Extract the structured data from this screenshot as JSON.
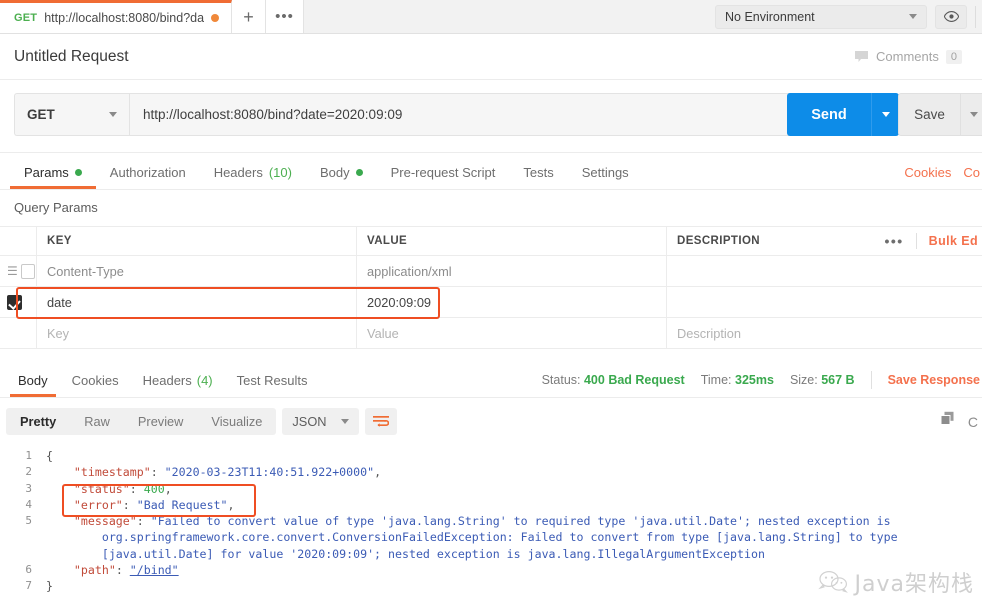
{
  "tabstrip": {
    "request_tab": {
      "method": "GET",
      "url": "http://localhost:8080/bind?date...",
      "unsaved": "unsaved-dot"
    },
    "new_tab_label": "+",
    "more_label": "•••",
    "environment": {
      "selected": "No Environment"
    }
  },
  "header": {
    "request_title": "Untitled Request",
    "comments_label": "Comments",
    "comments_count": "0"
  },
  "url_bar": {
    "method": "GET",
    "url": "http://localhost:8080/bind?date=2020:09:09",
    "send_label": "Send",
    "save_label": "Save"
  },
  "request_tabs": [
    {
      "label": "Params",
      "dot": true,
      "active": true
    },
    {
      "label": "Authorization",
      "dot": false,
      "active": false
    },
    {
      "label": "Headers",
      "count": "(10)",
      "dot": false,
      "active": false
    },
    {
      "label": "Body",
      "dot": true,
      "active": false
    },
    {
      "label": "Pre-request Script",
      "dot": false,
      "active": false
    },
    {
      "label": "Tests",
      "dot": false,
      "active": false
    },
    {
      "label": "Settings",
      "dot": false,
      "active": false
    }
  ],
  "request_links": {
    "cookies": "Cookies",
    "code": "Co"
  },
  "params": {
    "section_label": "Query Params",
    "columns": {
      "key": "KEY",
      "value": "VALUE",
      "description": "DESCRIPTION"
    },
    "more_label": "•••",
    "bulk_edit_label": "Bulk Ed",
    "rows": [
      {
        "checked": false,
        "key": "Content-Type",
        "value": "application/xml",
        "description": "",
        "placeholder": false,
        "highlighted": false
      },
      {
        "checked": true,
        "key": "date",
        "value": "2020:09:09",
        "description": "",
        "placeholder": false,
        "highlighted": true
      },
      {
        "checked": false,
        "key": "Key",
        "value": "Value",
        "description": "Description",
        "placeholder": true,
        "highlighted": false
      }
    ]
  },
  "response": {
    "tabs": [
      {
        "label": "Body",
        "active": true
      },
      {
        "label": "Cookies",
        "active": false
      },
      {
        "label": "Headers",
        "count": "(4)",
        "active": false
      },
      {
        "label": "Test Results",
        "active": false
      }
    ],
    "status_label": "Status:",
    "status_value": "400 Bad Request",
    "time_label": "Time:",
    "time_value": "325ms",
    "size_label": "Size:",
    "size_value": "567 B",
    "save_response_label": "Save Response"
  },
  "viewer": {
    "modes": [
      {
        "label": "Pretty",
        "active": true
      },
      {
        "label": "Raw",
        "active": false
      },
      {
        "label": "Preview",
        "active": false
      },
      {
        "label": "Visualize",
        "active": false
      }
    ],
    "format": "JSON",
    "wrap_icon": "wrap-lines-icon",
    "copy_icon": "copy-icon",
    "search_icon": "C"
  },
  "body_lines": [
    {
      "no": "1",
      "indent": 0,
      "segments": [
        {
          "t": "{",
          "c": "p"
        }
      ]
    },
    {
      "no": "2",
      "indent": 0,
      "segments": [
        {
          "t": "    ",
          "c": "p"
        },
        {
          "t": "\"timestamp\"",
          "c": "k"
        },
        {
          "t": ": ",
          "c": "p"
        },
        {
          "t": "\"2020-03-23T11:40:51.922+0000\"",
          "c": "s"
        },
        {
          "t": ",",
          "c": "p"
        }
      ]
    },
    {
      "no": "3",
      "indent": 0,
      "segments": [
        {
          "t": "    ",
          "c": "p"
        },
        {
          "t": "\"status\"",
          "c": "k"
        },
        {
          "t": ": ",
          "c": "p"
        },
        {
          "t": "400",
          "c": "n"
        },
        {
          "t": ",",
          "c": "p"
        }
      ]
    },
    {
      "no": "4",
      "indent": 0,
      "segments": [
        {
          "t": "    ",
          "c": "p"
        },
        {
          "t": "\"error\"",
          "c": "k"
        },
        {
          "t": ": ",
          "c": "p"
        },
        {
          "t": "\"Bad Request\"",
          "c": "s"
        },
        {
          "t": ",",
          "c": "p"
        }
      ]
    },
    {
      "no": "5",
      "indent": 0,
      "segments": [
        {
          "t": "    ",
          "c": "p"
        },
        {
          "t": "\"message\"",
          "c": "k"
        },
        {
          "t": ": ",
          "c": "p"
        },
        {
          "t": "\"Failed to convert value of type 'java.lang.String' to required type 'java.util.Date'; nested exception is",
          "c": "s"
        }
      ]
    },
    {
      "no": "",
      "indent": 0,
      "segments": [
        {
          "t": "        org.springframework.core.convert.ConversionFailedException: Failed to convert from type [java.lang.String] to type",
          "c": "s"
        }
      ]
    },
    {
      "no": "",
      "indent": 0,
      "segments": [
        {
          "t": "        [java.util.Date] for value '2020:09:09'; nested exception is java.lang.IllegalArgumentException",
          "c": "s"
        }
      ]
    },
    {
      "no": "6",
      "indent": 0,
      "segments": [
        {
          "t": "    ",
          "c": "p"
        },
        {
          "t": "\"path\"",
          "c": "k"
        },
        {
          "t": ": ",
          "c": "p"
        },
        {
          "t": "\"/bind\"",
          "c": "lnk"
        }
      ]
    },
    {
      "no": "7",
      "indent": 0,
      "segments": [
        {
          "t": "}",
          "c": "p"
        }
      ]
    }
  ],
  "watermark": {
    "text": "Java架构栈",
    "icon": "wechat-icon"
  }
}
